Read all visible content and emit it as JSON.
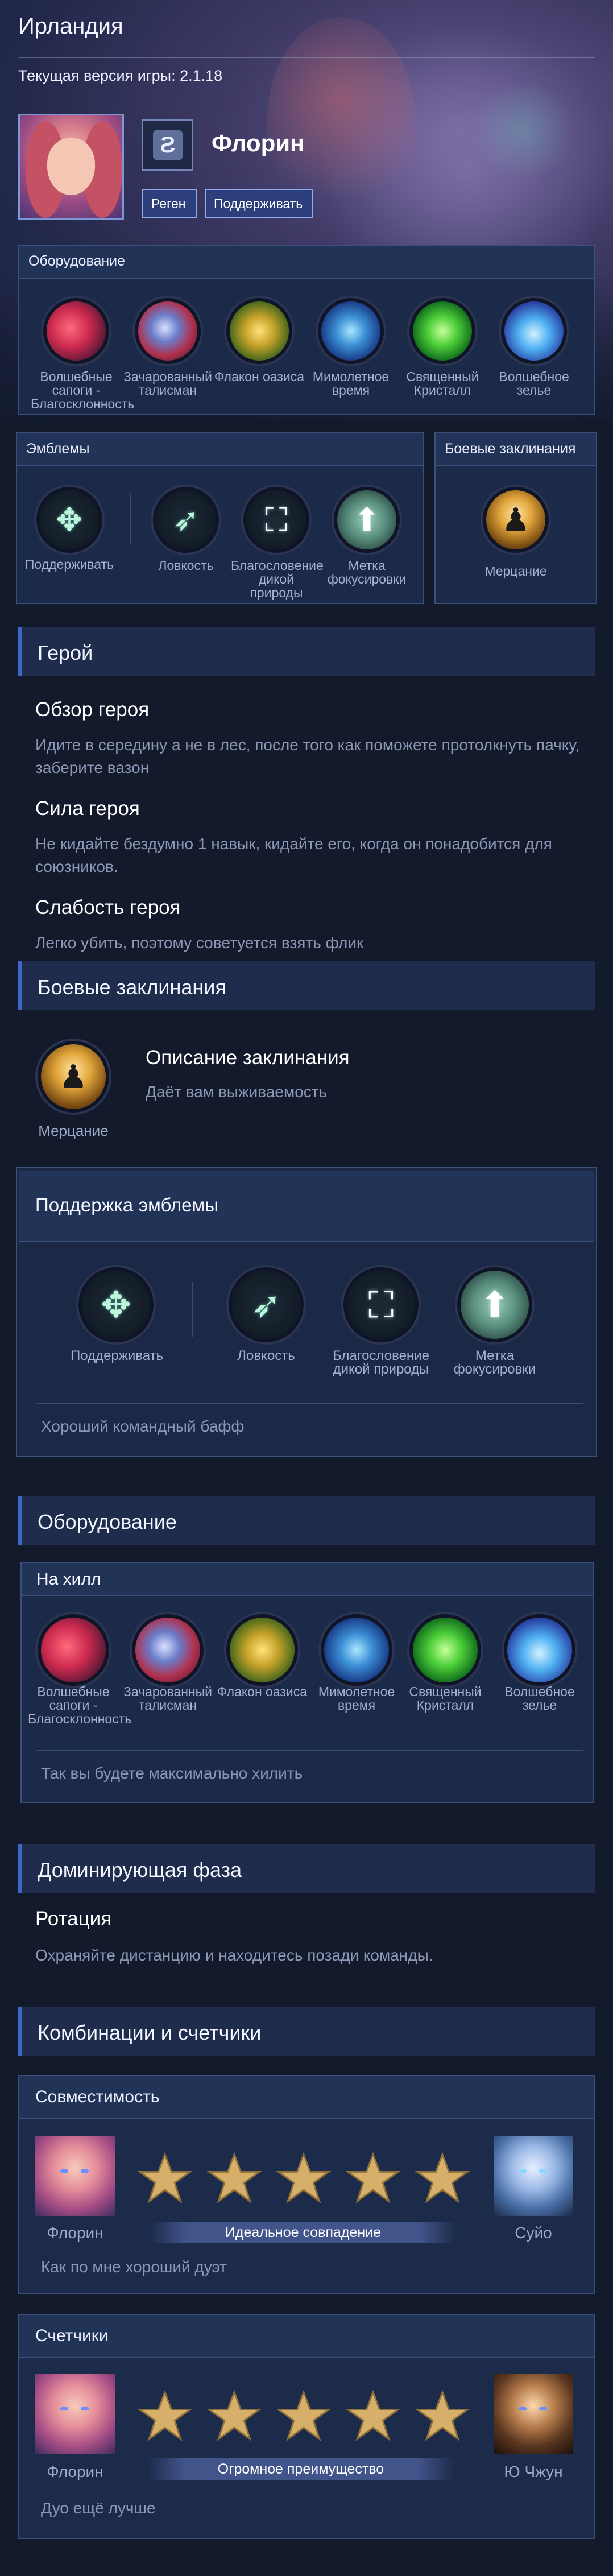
{
  "header": {
    "title": "Ирландия",
    "version": "Текущая версия игры: 2.1.18",
    "hero_name": "Флорин",
    "role_icon": "support-role-icon",
    "tags": [
      "Реген",
      "Поддерживать"
    ]
  },
  "equipment_panel": {
    "title": "Оборудование",
    "items": [
      {
        "name": "Волшебные сапоги - Благосклонность",
        "icon": "boots-icon"
      },
      {
        "name": "Зачарованный талисман",
        "icon": "talisman-icon"
      },
      {
        "name": "Флакон оазиса",
        "icon": "flask-icon"
      },
      {
        "name": "Мимолетное время",
        "icon": "hourglass-icon"
      },
      {
        "name": "Священный Кристалл",
        "icon": "crystal-icon"
      },
      {
        "name": "Волшебное зелье",
        "icon": "potion-icon"
      }
    ]
  },
  "emblems_panel": {
    "title": "Эмблемы",
    "items": [
      {
        "name": "Поддерживать",
        "icon": "support-emblem-icon"
      },
      {
        "name": "Ловкость",
        "icon": "agility-icon"
      },
      {
        "name": "Благословение дикой природы",
        "icon": "wild-blessing-icon"
      },
      {
        "name": "Метка фокусировки",
        "icon": "focus-mark-icon"
      }
    ]
  },
  "spells_panel": {
    "title": "Боевые заклинания",
    "spell": "Мерцание"
  },
  "hero_section": {
    "title": "Герой",
    "overview_title": "Обзор героя",
    "overview_text": "Идите в середину а не в лес, после того как поможете протолкнуть пачку, заберите вазон",
    "strength_title": "Сила героя",
    "strength_text": "Не кидайте бездумно 1 навык, кидайте его, когда он понадобится для союзников.",
    "weakness_title": "Слабость героя",
    "weakness_text": "Легко убить, поэтому советуется взять флик"
  },
  "spells_section": {
    "title": "Боевые заклинания",
    "spell": "Мерцание",
    "desc_title": "Описание заклинания",
    "desc_text": "Даёт вам выживаемость"
  },
  "emblem_section": {
    "title": "Поддержка эмблемы",
    "items": [
      "Поддерживать",
      "Ловкость",
      "Благословение дикой природы",
      "Метка фокусировки"
    ],
    "note": "Хороший командный бафф"
  },
  "equipment_section": {
    "title": "Оборудование",
    "build_title": "На хилл",
    "items": [
      "Волшебные сапоги - Благосклонность",
      "Зачарованный талисман",
      "Флакон оазиса",
      "Мимолетное время",
      "Священный Кристалл",
      "Волшебное зелье"
    ],
    "note": "Так вы будете максимально хилить"
  },
  "phase_section": {
    "title": "Доминирующая фаза",
    "rotation_title": "Ротация",
    "rotation_text": "Охраняйте дистанцию и находитесь позади команды."
  },
  "combos_section": {
    "title": "Комбинации и счетчики",
    "compat": {
      "title": "Совместимость",
      "left_hero": "Флорин",
      "right_hero": "Суйо",
      "stars": 5,
      "match_label": "Идеальное совпадение",
      "note": "Как по мне хороший дуэт"
    },
    "counters": {
      "title": "Счетчики",
      "left_hero": "Флорин",
      "right_hero": "Ю Чжун",
      "stars": 5,
      "match_label": "Огромное преимущество",
      "note": "Дуо ещё лучше"
    }
  },
  "colors": {
    "accent": "#3f66c9",
    "panel": "#1c2a49",
    "background": "#121a2c",
    "star": "#d6b06a"
  }
}
